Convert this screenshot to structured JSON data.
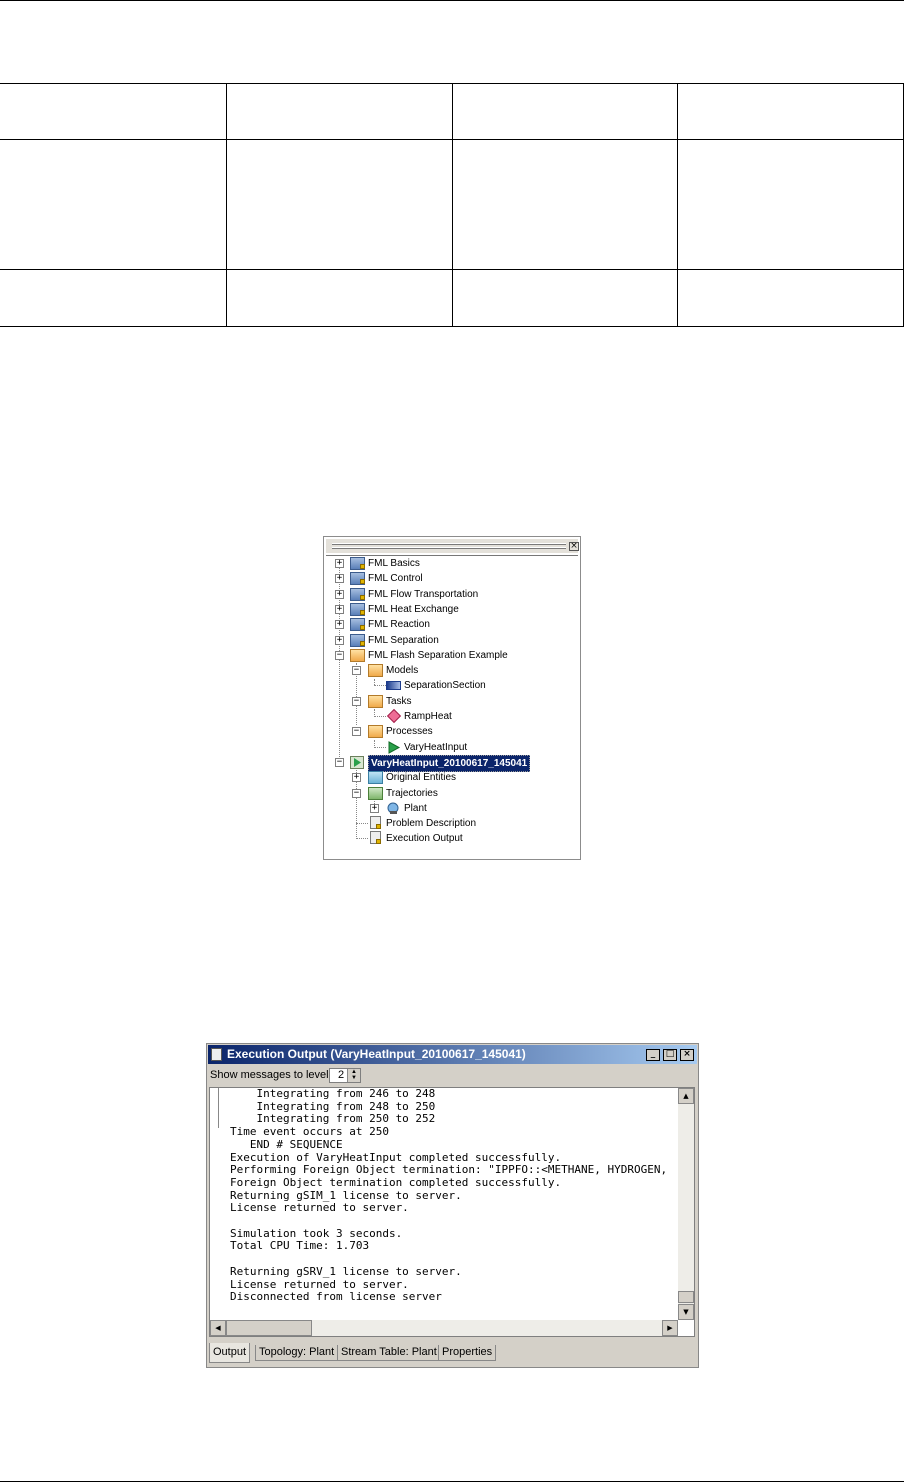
{
  "tree": {
    "close_icon": "close-icon",
    "items": [
      {
        "label": "FML Basics"
      },
      {
        "label": "FML Control"
      },
      {
        "label": "FML Flow Transportation"
      },
      {
        "label": "FML Heat Exchange"
      },
      {
        "label": "FML Reaction"
      },
      {
        "label": "FML Separation"
      },
      {
        "label": "FML Flash Separation Example"
      },
      {
        "label": "Models"
      },
      {
        "label": "SeparationSection"
      },
      {
        "label": "Tasks"
      },
      {
        "label": "RampHeat"
      },
      {
        "label": "Processes"
      },
      {
        "label": "VaryHeatInput"
      },
      {
        "label": "VaryHeatInput_20100617_145041"
      },
      {
        "label": "Original Entities"
      },
      {
        "label": "Trajectories"
      },
      {
        "label": "Plant"
      },
      {
        "label": "Problem Description"
      },
      {
        "label": "Execution Output"
      }
    ]
  },
  "exec_window": {
    "title": "Execution Output (VaryHeatInput_20100617_145041)",
    "minimize": "_",
    "maximize": "□",
    "close": "×",
    "level_label": "Show messages to level",
    "level_value": "2",
    "output": "    Integrating from 246 to 248\n    Integrating from 248 to 250\n    Integrating from 250 to 252\nTime event occurs at 250\n   END # SEQUENCE\nExecution of VaryHeatInput completed successfully.\nPerforming Foreign Object termination: \"IPPFO::<METHANE, HYDROGEN,\nForeign Object termination completed successfully.\nReturning gSIM_1 license to server.\nLicense returned to server.\n\nSimulation took 3 seconds.\nTotal CPU Time: 1.703\n\nReturning gSRV_1 license to server.\nLicense returned to server.\nDisconnected from license server",
    "tabs": [
      "Output",
      "Topology: Plant",
      "Stream Table: Plant",
      "Properties"
    ]
  }
}
